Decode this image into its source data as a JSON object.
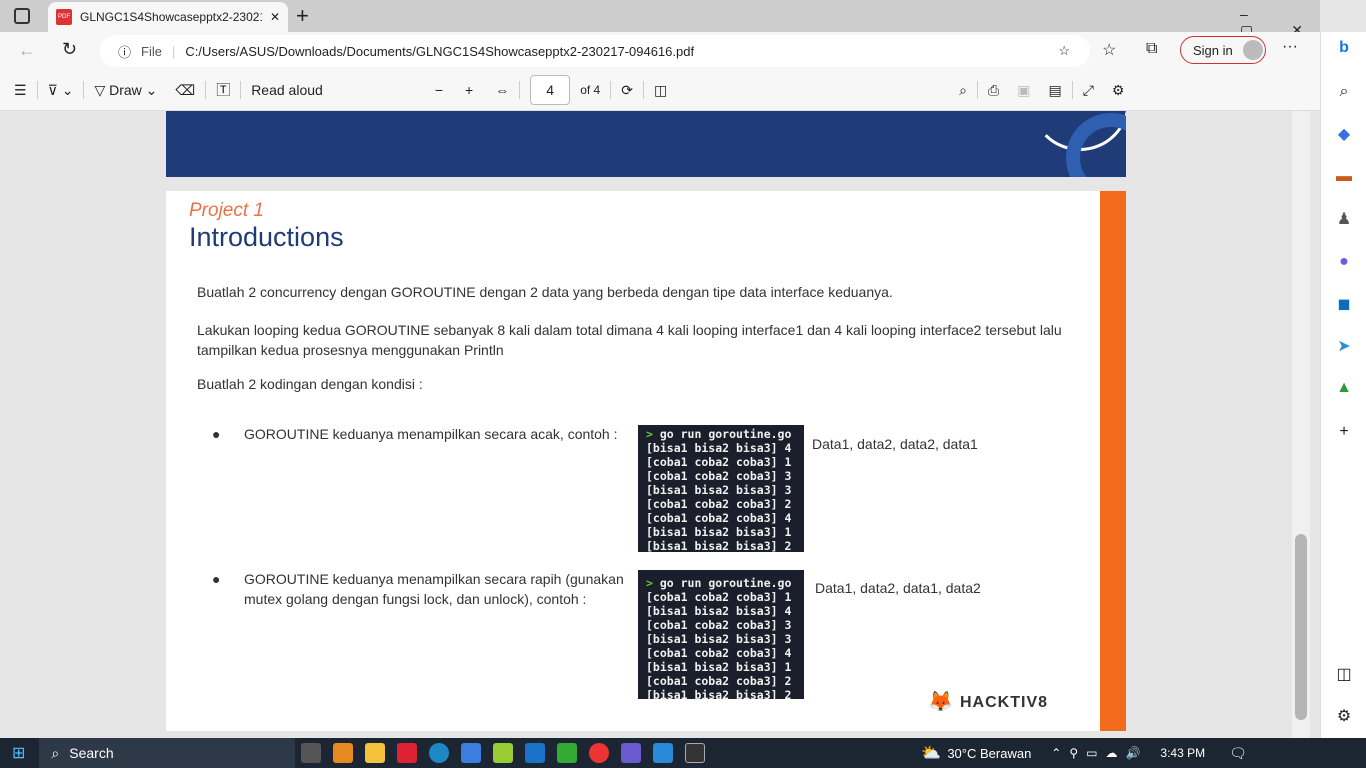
{
  "browser": {
    "tab_title": "GLNGC1S4Showcasepptx2-23021",
    "file_label": "File",
    "url": "C:/Users/ASUS/Downloads/Documents/GLNGC1S4Showcasepptx2-230217-094616.pdf",
    "sign_in": "Sign in"
  },
  "pdf_toolbar": {
    "draw": "Draw",
    "read_aloud": "Read aloud",
    "page": "4",
    "of_pages": "of 4"
  },
  "slide": {
    "subtitle": "Project 1",
    "title": "Introductions",
    "p1": "Buatlah 2 concurrency dengan GOROUTINE dengan 2 data yang berbeda dengan tipe data interface keduanya.",
    "p2": "Lakukan looping kedua GOROUTINE sebanyak 8 kali dalam total dimana 4 kali looping interface1 dan 4 kali looping interface2 tersebut lalu tampilkan kedua prosesnya menggunakan Println",
    "p3": "Buatlah 2 kodingan dengan kondisi :",
    "bullet1": "GOROUTINE keduanya menampilkan secara acak, contoh :",
    "bullet2": "GOROUTINE keduanya menampilkan secara rapih (gunakan mutex golang dengan fungsi lock, dan unlock), contoh :",
    "result1": "Data1, data2, data2, data1",
    "result2": "Data1, data2, data1, data2",
    "prompt": ">",
    "command": " go run goroutine.go",
    "term1": [
      "[bisa1 bisa2 bisa3] 4",
      "[coba1 coba2 coba3] 1",
      "[coba1 coba2 coba3] 3",
      "[bisa1 bisa2 bisa3] 3",
      "[coba1 coba2 coba3] 2",
      "[coba1 coba2 coba3] 4",
      "[bisa1 bisa2 bisa3] 1",
      "[bisa1 bisa2 bisa3] 2"
    ],
    "term2": [
      "[coba1 coba2 coba3] 1",
      "[bisa1 bisa2 bisa3] 4",
      "[coba1 coba2 coba3] 3",
      "[bisa1 bisa2 bisa3] 3",
      "[coba1 coba2 coba3] 4",
      "[bisa1 bisa2 bisa3] 1",
      "[coba1 coba2 coba3] 2",
      "[bisa1 bisa2 bisa3] 2"
    ],
    "logo": "HACKTIV8"
  },
  "taskbar": {
    "search": "Search",
    "weather": "30°C  Berawan",
    "time": "3:43 PM"
  },
  "colors": {
    "accent_orange": "#f26b1d",
    "navy": "#1f3c78",
    "subtitle": "#e8734a"
  }
}
